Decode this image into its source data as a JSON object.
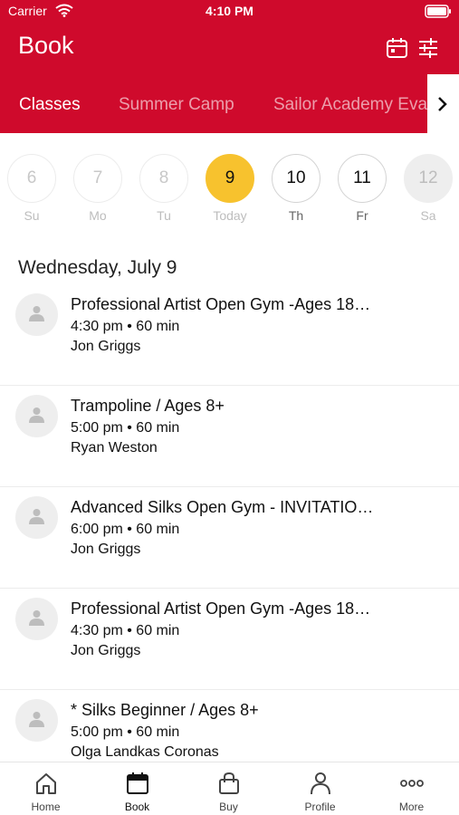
{
  "status": {
    "carrier": "Carrier",
    "time": "4:10 PM"
  },
  "header": {
    "title": "Book",
    "background": "#cf0a2c"
  },
  "tabs": [
    {
      "label": "Classes",
      "active": true
    },
    {
      "label": "Summer Camp",
      "active": false
    },
    {
      "label": "Sailor Academy Eva",
      "active": false
    }
  ],
  "week": [
    {
      "num": "6",
      "label": "Su",
      "state": "past"
    },
    {
      "num": "7",
      "label": "Mo",
      "state": "past"
    },
    {
      "num": "8",
      "label": "Tu",
      "state": "past"
    },
    {
      "num": "9",
      "label": "Today",
      "state": "selected"
    },
    {
      "num": "10",
      "label": "Th",
      "state": "open"
    },
    {
      "num": "11",
      "label": "Fr",
      "state": "open"
    },
    {
      "num": "12",
      "label": "Sa",
      "state": "disabled"
    }
  ],
  "date_heading": "Wednesday, July 9",
  "classes": [
    {
      "title": "Professional Artist Open Gym -Ages 18…",
      "time": "4:30 pm • 60 min",
      "instructor": "Jon Griggs"
    },
    {
      "title": "Trampoline / Ages 8+",
      "time": "5:00 pm • 60 min",
      "instructor": "Ryan Weston"
    },
    {
      "title": "Advanced Silks Open Gym - INVITATIO…",
      "time": "6:00 pm • 60 min",
      "instructor": "Jon Griggs"
    },
    {
      "title": "Professional Artist Open Gym -Ages 18…",
      "time": "4:30 pm • 60 min",
      "instructor": "Jon Griggs"
    },
    {
      "title": "* Silks Beginner / Ages 8+",
      "time": "5:00 pm • 60 min",
      "instructor": "Olga Landkas Coronas"
    }
  ],
  "tab_bar": [
    {
      "label": "Home",
      "icon": "home-icon"
    },
    {
      "label": "Book",
      "icon": "calendar-icon"
    },
    {
      "label": "Buy",
      "icon": "bag-icon"
    },
    {
      "label": "Profile",
      "icon": "person-icon"
    },
    {
      "label": "More",
      "icon": "more-icon"
    }
  ],
  "colors": {
    "accent": "#cf0a2c",
    "selected_day": "#f7c22e"
  }
}
